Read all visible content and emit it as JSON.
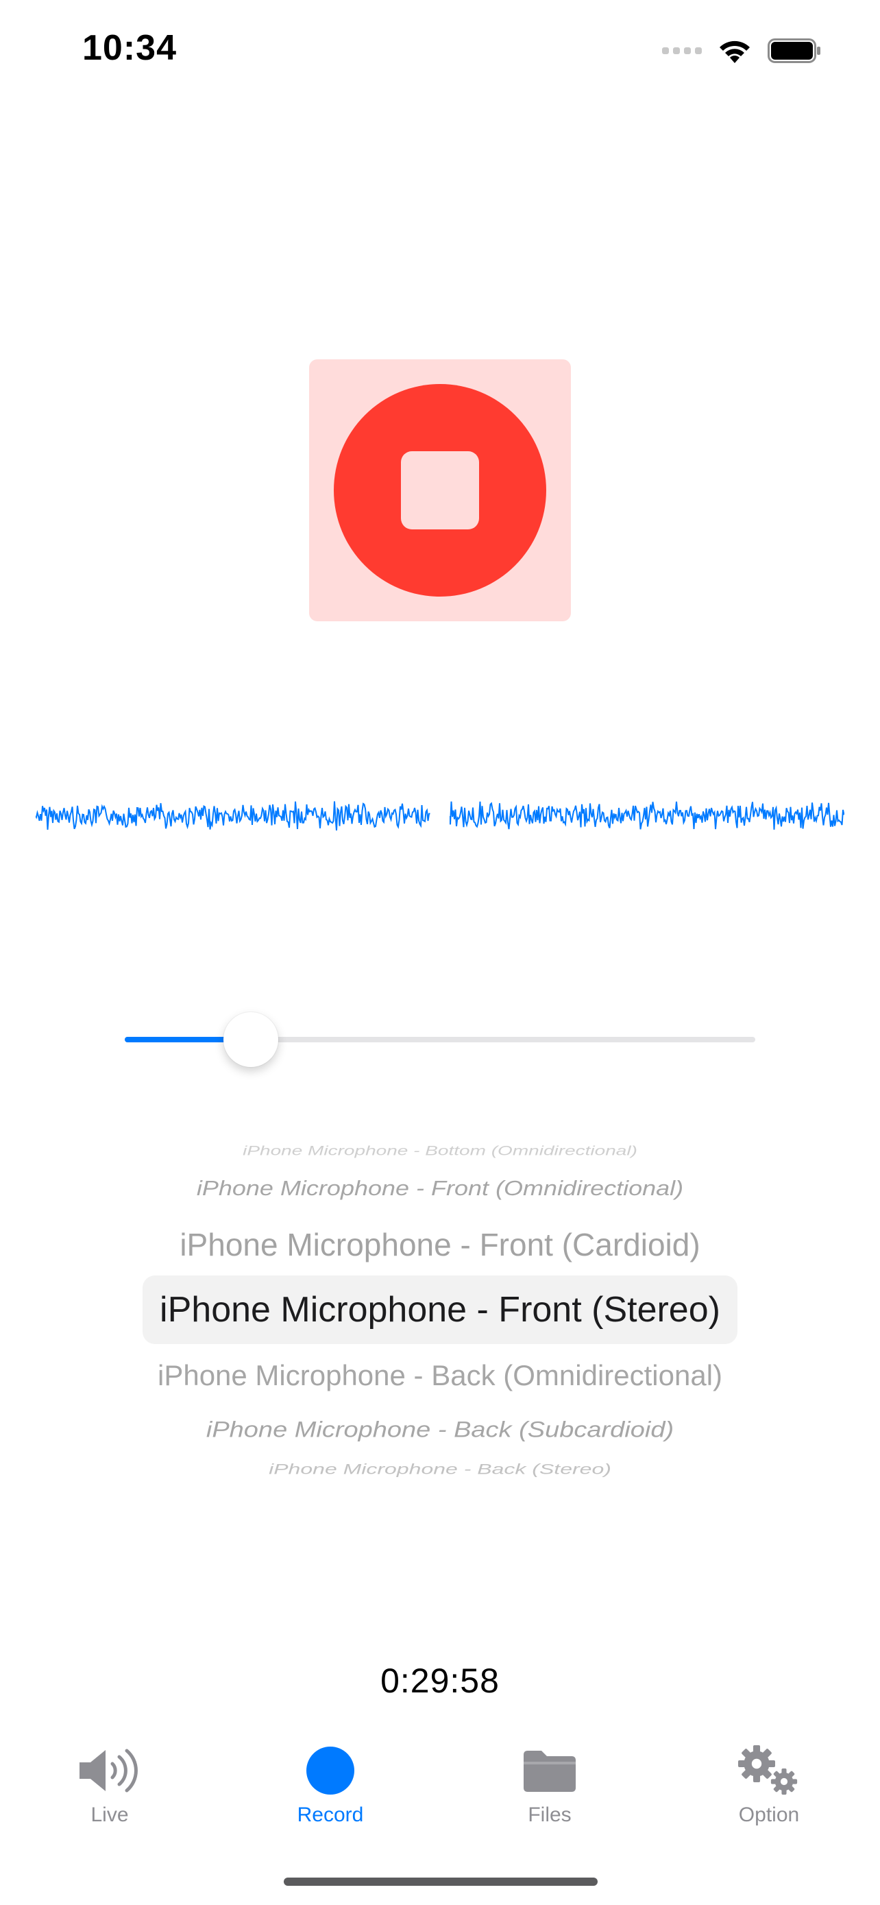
{
  "status_bar": {
    "time": "10:34",
    "signal_icon": "cellular-dots-icon",
    "wifi_icon": "wifi-icon",
    "battery_icon": "battery-icon"
  },
  "record_button": {
    "state": "recording",
    "icon": "stop-icon",
    "colors": {
      "background": "#ffdcdb",
      "circle": "#ff3b30"
    }
  },
  "waveform": {
    "color": "#007aff",
    "channels": [
      "left",
      "right"
    ]
  },
  "gain_slider": {
    "value": 0.2,
    "track_color": "#e4e4e6",
    "fill_color": "#007aff"
  },
  "microphone_picker": {
    "options": [
      "iPhone Microphone - Bottom (Omnidirectional)",
      "iPhone Microphone - Front (Omnidirectional)",
      "iPhone Microphone - Front (Cardioid)",
      "iPhone Microphone - Front (Stereo)",
      "iPhone Microphone - Back (Omnidirectional)",
      "iPhone Microphone - Back (Subcardioid)",
      "iPhone Microphone - Back (Stereo)"
    ],
    "selected": "iPhone Microphone - Front (Stereo)"
  },
  "timer": "0:29:58",
  "tab_bar": {
    "active_color": "#007aff",
    "inactive_color": "#8e8e93",
    "tabs": [
      {
        "label": "Live",
        "icon": "speaker-icon",
        "active": false
      },
      {
        "label": "Record",
        "icon": "record-dot-icon",
        "active": true
      },
      {
        "label": "Files",
        "icon": "folder-icon",
        "active": false
      },
      {
        "label": "Option",
        "icon": "gears-icon",
        "active": false
      }
    ]
  }
}
